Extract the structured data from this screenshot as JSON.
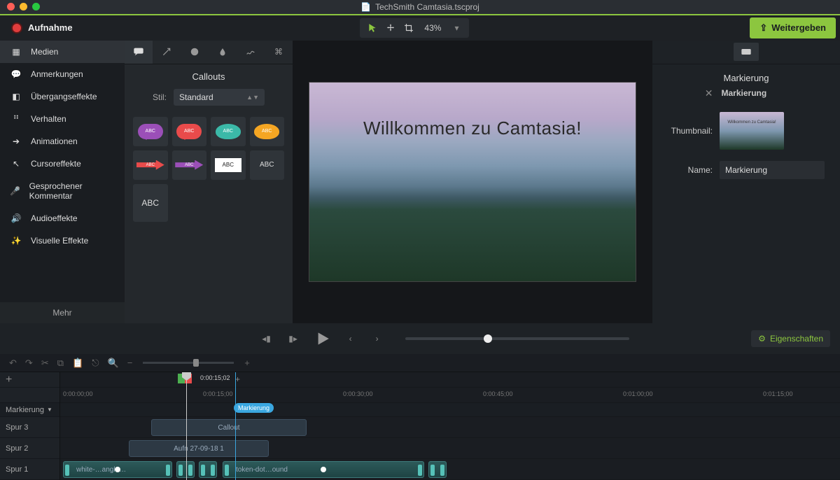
{
  "titlebar": {
    "filename": "TechSmith Camtasia.tscproj"
  },
  "toolbar": {
    "record_label": "Aufnahme",
    "zoom": "43%",
    "share_label": "Weitergeben"
  },
  "sidebar": {
    "items": [
      {
        "label": "Medien"
      },
      {
        "label": "Anmerkungen"
      },
      {
        "label": "Übergangseffekte"
      },
      {
        "label": "Verhalten"
      },
      {
        "label": "Animationen"
      },
      {
        "label": "Cursoreffekte"
      },
      {
        "label": "Gesprochener Kommentar"
      },
      {
        "label": "Audioeffekte"
      },
      {
        "label": "Visuelle Effekte"
      }
    ],
    "more": "Mehr"
  },
  "panel": {
    "title": "Callouts",
    "style_label": "Stil:",
    "style_value": "Standard",
    "sample_text": "ABC"
  },
  "canvas": {
    "headline": "Willkommen zu Camtasia!"
  },
  "properties": {
    "heading": "Markierung",
    "subheading": "Markierung",
    "thumbnail_label": "Thumbnail:",
    "thumb_text": "Willkommen zu Camtasia!",
    "name_label": "Name:",
    "name_value": "Markierung",
    "toggle_label": "Eigenschaften"
  },
  "timeline": {
    "playhead_time": "0:00:15;02",
    "marker_row_label": "Markierung",
    "marker_tag": "Markierung",
    "ticks": [
      "0:00:00;00",
      "0:00:15;00",
      "0:00:30;00",
      "0:00:45;00",
      "0:01:00;00",
      "0:01:15;00"
    ],
    "tracks": [
      {
        "name": "Spur 3"
      },
      {
        "name": "Spur 2"
      },
      {
        "name": "Spur 1"
      }
    ],
    "clips": {
      "callout": "Callout",
      "aufn": "Aufn 27-09-18 1",
      "white": "white-…angle…",
      "token": "token-dot…ound"
    }
  }
}
